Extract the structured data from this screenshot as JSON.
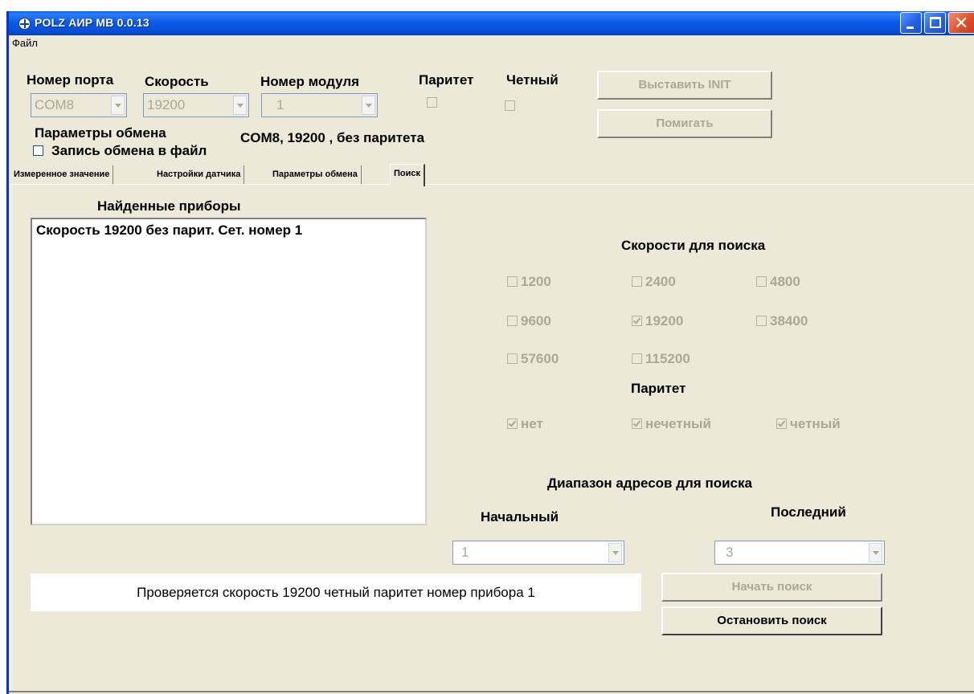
{
  "window": {
    "title": "POLZ АИР МВ 0.0.13"
  },
  "menu": {
    "file": "Файл"
  },
  "header": {
    "port_label": "Номер порта",
    "speed_label": "Скорость",
    "module_label": "Номер модуля",
    "parity_label": "Паритет",
    "even_label": "Четный",
    "port_value": "COM8",
    "speed_value": "19200",
    "module_value": "1",
    "exchange_params_label": "Параметры обмена",
    "exchange_params_value": "COM8, 19200 , без паритета",
    "log_to_file_label": "Запись обмена в файл",
    "set_init_button": "Выставить INIT",
    "blink_button": "Помигать"
  },
  "tabs": [
    {
      "label": "Измеренное значение"
    },
    {
      "label": "Настройки датчика"
    },
    {
      "label": "Параметры обмена"
    },
    {
      "label": "Поиск",
      "active": true
    }
  ],
  "search": {
    "found_title": "Найденные приборы",
    "found_items": [
      "Скорость 19200  без парит. Сет. номер 1"
    ],
    "speeds_title": "Скорости для поиска",
    "speeds": [
      {
        "label": "1200",
        "checked": false
      },
      {
        "label": "2400",
        "checked": false
      },
      {
        "label": "4800",
        "checked": false
      },
      {
        "label": "9600",
        "checked": false
      },
      {
        "label": "19200",
        "checked": true
      },
      {
        "label": "38400",
        "checked": false
      },
      {
        "label": "57600",
        "checked": false
      },
      {
        "label": "115200",
        "checked": false
      }
    ],
    "parity_title": "Паритет",
    "parity_options": [
      {
        "label": "нет",
        "checked": true
      },
      {
        "label": "нечетный",
        "checked": true
      },
      {
        "label": "четный",
        "checked": true
      }
    ],
    "address_range_title": "Диапазон адресов для поиска",
    "start_label": "Начальный",
    "last_label": "Последний",
    "start_value": "1",
    "last_value": "3",
    "start_search_button": "Начать поиск",
    "stop_search_button": "Остановить поиск",
    "status_text": "Проверяется скорость 19200 четный паритет номер прибора 1"
  }
}
